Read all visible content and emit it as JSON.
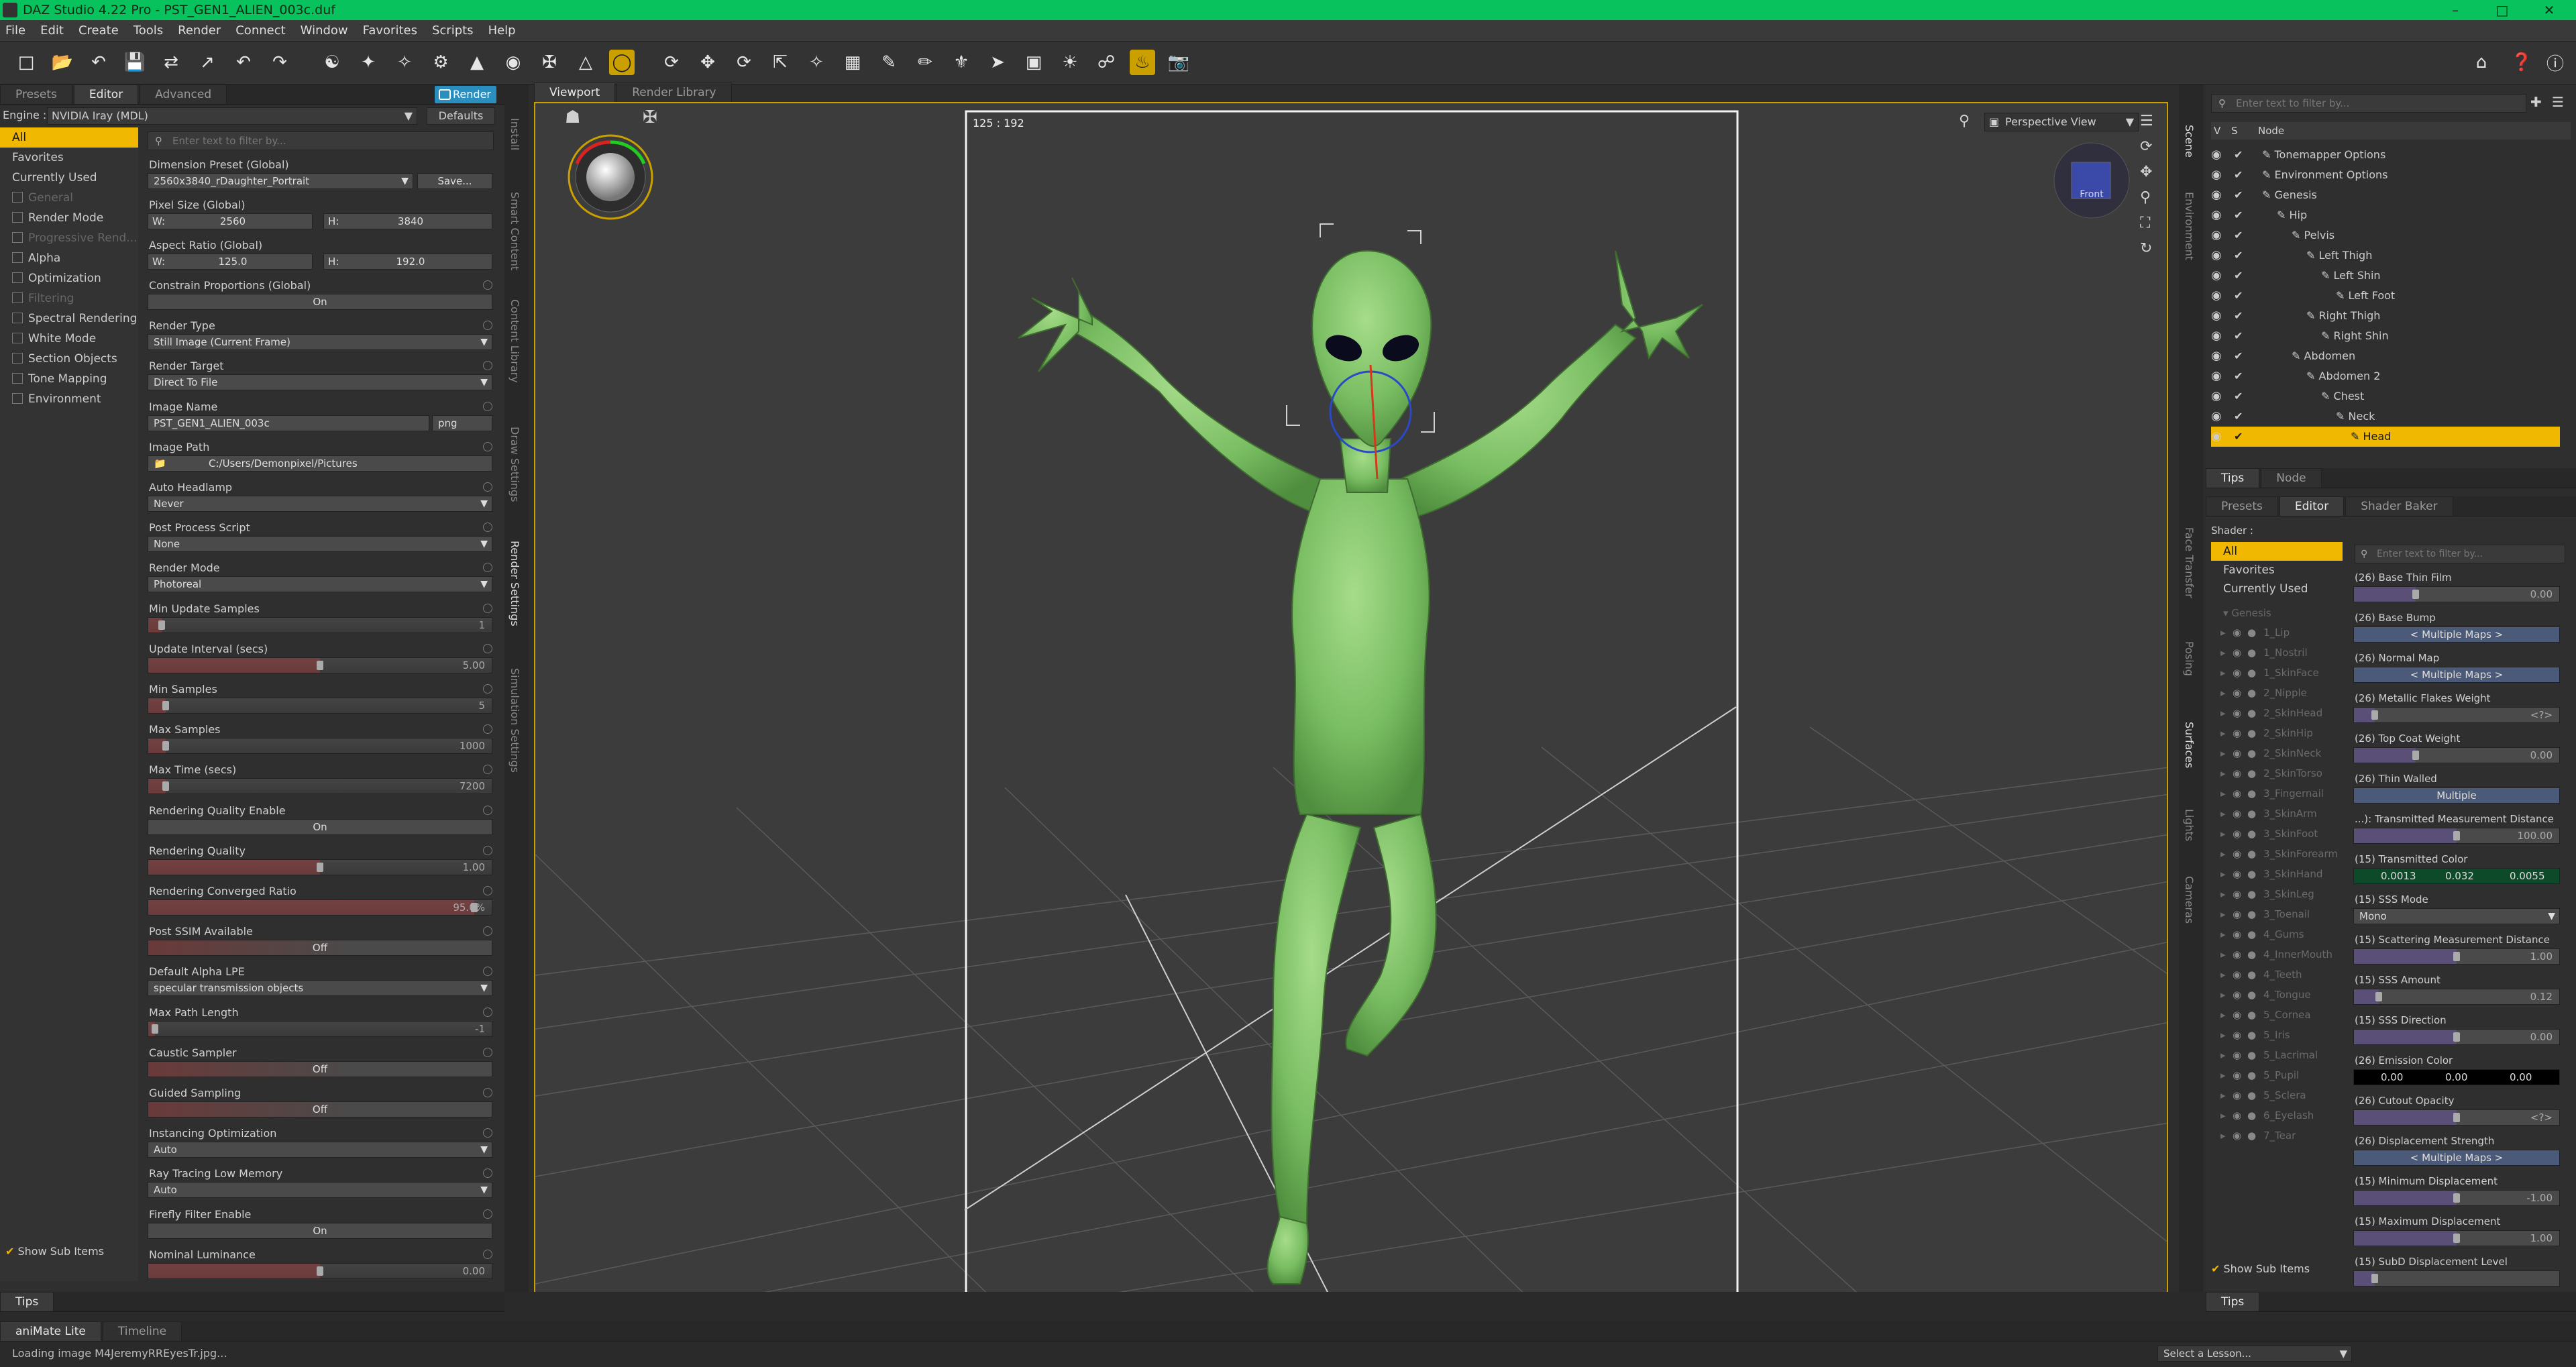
{
  "window": {
    "title": "DAZ Studio 4.22 Pro - PST_GEN1_ALIEN_003c.duf"
  },
  "menu": [
    "File",
    "Edit",
    "Create",
    "Tools",
    "Render",
    "Connect",
    "Window",
    "Favorites",
    "Scripts",
    "Help"
  ],
  "toolbar_icons": [
    "new-file-icon",
    "open-file-icon",
    "open-recent-icon",
    "save-icon",
    "merge-icon",
    "export-icon",
    "undo-icon",
    "redo-icon",
    "create-figure-icon",
    "joint-editor-icon",
    "node-weight-icon",
    "rigging-icon",
    "region-icon",
    "surface-selection-icon",
    "pose-tool-icon",
    "geometry-editor-icon",
    "universal-tool-icon",
    "active-pose-icon",
    "translate-icon",
    "rotate-icon",
    "scale-icon",
    "spot-render-icon",
    "uv-icon",
    "morph-brush-icon",
    "weight-brush-icon",
    "deform-icon",
    "node-select-icon",
    "camera-icon",
    "light-icon",
    "link-icon",
    "render-icon",
    "snapshot-icon"
  ],
  "render_panel": {
    "tabs": [
      "Presets",
      "Editor",
      "Advanced"
    ],
    "render_button": "Render",
    "engine_label": "Engine :",
    "engine_value": "NVIDIA Iray (MDL)",
    "defaults_button": "Defaults",
    "filter_placeholder": "Enter text to filter by...",
    "categories": [
      {
        "label": "All",
        "selected": true,
        "dim": false,
        "box": false
      },
      {
        "label": "Favorites",
        "selected": false,
        "dim": false,
        "box": false
      },
      {
        "label": "Currently Used",
        "selected": false,
        "dim": false,
        "box": false
      },
      {
        "label": "General",
        "selected": false,
        "dim": true,
        "box": true
      },
      {
        "label": "Render Mode",
        "selected": false,
        "dim": false,
        "box": true
      },
      {
        "label": "Progressive Rend...",
        "selected": false,
        "dim": true,
        "box": true
      },
      {
        "label": "Alpha",
        "selected": false,
        "dim": false,
        "box": true
      },
      {
        "label": "Optimization",
        "selected": false,
        "dim": false,
        "box": true
      },
      {
        "label": "Filtering",
        "selected": false,
        "dim": true,
        "box": true
      },
      {
        "label": "Spectral Rendering",
        "selected": false,
        "dim": false,
        "box": true
      },
      {
        "label": "White Mode",
        "selected": false,
        "dim": false,
        "box": true
      },
      {
        "label": "Section Objects",
        "selected": false,
        "dim": false,
        "box": true
      },
      {
        "label": "Tone Mapping",
        "selected": false,
        "dim": false,
        "box": true
      },
      {
        "label": "Environment",
        "selected": false,
        "dim": false,
        "box": true
      }
    ],
    "show_sub_items": "Show Sub Items",
    "side_tabs": [
      "Install",
      "Smart Content",
      "Content Library",
      "Draw Settings",
      "Render Settings",
      "Simulation Settings"
    ],
    "dimension_preset": {
      "label": "Dimension Preset (Global)",
      "value": "2560x3840_rDaughter_Portrait",
      "save": "Save..."
    },
    "pixel_size": {
      "label": "Pixel Size (Global)",
      "w_label": "W:",
      "w": "2560",
      "h_label": "H:",
      "h": "3840"
    },
    "aspect_ratio": {
      "label": "Aspect Ratio (Global)",
      "w_label": "W:",
      "w": "125.0",
      "h_label": "H:",
      "h": "192.0"
    },
    "properties": [
      {
        "label": "Constrain Proportions (Global)",
        "kind": "btn",
        "value": "On",
        "level": null
      },
      {
        "label": "Render Type",
        "kind": "drop",
        "value": "Still Image (Current Frame)",
        "level": null
      },
      {
        "label": "Render Target",
        "kind": "drop",
        "value": "Direct To File",
        "level": null
      },
      {
        "label": "Image Name",
        "kind": "text",
        "value": "PST_GEN1_ALIEN_003c",
        "level": null,
        "ext": "png"
      },
      {
        "label": "Image Path",
        "kind": "path",
        "value": "C:/Users/Demonpixel/Pictures",
        "level": null
      },
      {
        "label": "Auto Headlamp",
        "kind": "drop",
        "value": "Never",
        "level": null
      },
      {
        "label": "Post Process Script",
        "kind": "drop",
        "value": "None",
        "level": null
      },
      {
        "label": "Render Mode",
        "kind": "drop",
        "value": "Photoreal",
        "level": null
      },
      {
        "label": "Min Update Samples",
        "kind": "slider",
        "value": "1",
        "level": 0.04
      },
      {
        "label": "Update Interval (secs)",
        "kind": "slider",
        "value": "5.00",
        "level": 0.5
      },
      {
        "label": "Min Samples",
        "kind": "slider",
        "value": "5",
        "level": 0.05
      },
      {
        "label": "Max Samples",
        "kind": "slider",
        "value": "1000",
        "level": 0.05
      },
      {
        "label": "Max Time (secs)",
        "kind": "slider",
        "value": "7200",
        "level": 0.05
      },
      {
        "label": "Rendering Quality Enable",
        "kind": "btn",
        "value": "On",
        "level": null
      },
      {
        "label": "Rendering Quality",
        "kind": "slider",
        "value": "1.00",
        "level": 0.5
      },
      {
        "label": "Rendering Converged Ratio",
        "kind": "slider",
        "value": "95.0%",
        "level": 0.95
      },
      {
        "label": "Post SSIM Available",
        "kind": "btn",
        "value": "Off",
        "level": null
      },
      {
        "label": "Default Alpha LPE",
        "kind": "drop",
        "value": "specular transmission objects",
        "level": null
      },
      {
        "label": "Max Path Length",
        "kind": "slider",
        "value": "-1",
        "level": 0.02
      },
      {
        "label": "Caustic Sampler",
        "kind": "btn",
        "value": "Off",
        "level": null
      },
      {
        "label": "Guided Sampling",
        "kind": "btn",
        "value": "Off",
        "level": null
      },
      {
        "label": "Instancing Optimization",
        "kind": "drop",
        "value": "Auto",
        "level": null
      },
      {
        "label": "Ray Tracing Low Memory",
        "kind": "drop",
        "value": "Auto",
        "level": null
      },
      {
        "label": "Firefly Filter Enable",
        "kind": "btn",
        "value": "On",
        "level": null
      },
      {
        "label": "Nominal Luminance",
        "kind": "slider",
        "value": "0.00",
        "level": 0.5
      }
    ]
  },
  "viewport": {
    "tabs": [
      "Viewport",
      "Render Library"
    ],
    "frame_ratio": "125 : 192",
    "view_menu": "Perspective View",
    "cube_label": "Front"
  },
  "scene": {
    "filter_placeholder": "Enter text to filter by...",
    "header": [
      "V",
      "S",
      "Node"
    ],
    "nodes": [
      {
        "label": "Tonemapper Options",
        "indent": 0,
        "selected": false
      },
      {
        "label": "Environment Options",
        "indent": 0,
        "selected": false
      },
      {
        "label": "Genesis",
        "indent": 0,
        "selected": false
      },
      {
        "label": "Hip",
        "indent": 1,
        "selected": false
      },
      {
        "label": "Pelvis",
        "indent": 2,
        "selected": false
      },
      {
        "label": "Left Thigh",
        "indent": 3,
        "selected": false
      },
      {
        "label": "Left Shin",
        "indent": 4,
        "selected": false
      },
      {
        "label": "Left Foot",
        "indent": 5,
        "selected": false
      },
      {
        "label": "Right Thigh",
        "indent": 3,
        "selected": false
      },
      {
        "label": "Right Shin",
        "indent": 4,
        "selected": false
      },
      {
        "label": "Abdomen",
        "indent": 2,
        "selected": false
      },
      {
        "label": "Abdomen 2",
        "indent": 3,
        "selected": false
      },
      {
        "label": "Chest",
        "indent": 4,
        "selected": false
      },
      {
        "label": "Neck",
        "indent": 5,
        "selected": false
      },
      {
        "label": "Head",
        "indent": 6,
        "selected": true
      }
    ],
    "bottom_tabs": [
      "Tips",
      "Node"
    ],
    "side_tabs": [
      "Scene",
      "Environment"
    ]
  },
  "surfaces": {
    "tabs": [
      "Presets",
      "Editor",
      "Shader Baker"
    ],
    "shader_label": "Shader :",
    "filter_placeholder": "Enter text to filter by...",
    "categories": [
      "All",
      "Favorites",
      "Currently Used"
    ],
    "root": "Genesis",
    "materials": [
      "1_Lip",
      "1_Nostril",
      "1_SkinFace",
      "2_Nipple",
      "2_SkinHead",
      "2_SkinHip",
      "2_SkinNeck",
      "2_SkinTorso",
      "3_Fingernail",
      "3_SkinArm",
      "3_SkinFoot",
      "3_SkinForearm",
      "3_SkinHand",
      "3_SkinLeg",
      "3_Toenail",
      "4_Gums",
      "4_InnerMouth",
      "4_Teeth",
      "4_Tongue",
      "5_Cornea",
      "5_Iris",
      "5_Lacrimal",
      "5_Pupil",
      "5_Sclera",
      "6_Eyelash",
      "7_Tear"
    ],
    "side_tabs": [
      "Face Transfer",
      "Posing",
      "Surfaces",
      "Lights",
      "Cameras"
    ],
    "properties": [
      {
        "label": "(26) Base Thin Film",
        "kind": "slider",
        "value": "0.00",
        "level": 0.3
      },
      {
        "label": "(26) Base Bump",
        "kind": "maps",
        "value": "< Multiple Maps >",
        "level": null
      },
      {
        "label": "(26) Normal Map",
        "kind": "maps",
        "value": "< Multiple Maps >",
        "level": null
      },
      {
        "label": "(26) Metallic Flakes Weight",
        "kind": "slider",
        "value": "<?>",
        "level": 0.1
      },
      {
        "label": "(26) Top Coat Weight",
        "kind": "slider",
        "value": "0.00",
        "level": 0.3
      },
      {
        "label": "(26) Thin Walled",
        "kind": "maps",
        "value": "Multiple",
        "level": null
      },
      {
        "label": "...): Transmitted Measurement Distance",
        "kind": "slider",
        "value": "100.00",
        "level": 0.5
      },
      {
        "label": "(15) Transmitted Color",
        "kind": "color",
        "value": "",
        "level": null,
        "c1": "0.0013",
        "c2": "0.032",
        "c3": "0.0055"
      },
      {
        "label": "(15) SSS Mode",
        "kind": "drop",
        "value": "Mono",
        "level": null
      },
      {
        "label": "(15) Scattering Measurement Distance",
        "kind": "slider",
        "value": "1.00",
        "level": 0.5
      },
      {
        "label": "(15) SSS Amount",
        "kind": "slider",
        "value": "0.12",
        "level": 0.12
      },
      {
        "label": "(15) SSS Direction",
        "kind": "slider",
        "value": "0.00",
        "level": 0.5
      },
      {
        "label": "(26) Emission Color",
        "kind": "color2",
        "value": "",
        "level": null,
        "c1": "0.00",
        "c2": "0.00",
        "c3": "0.00"
      },
      {
        "label": "(26) Cutout Opacity",
        "kind": "slider",
        "value": "<?>",
        "level": 0.5
      },
      {
        "label": "(26) Displacement Strength",
        "kind": "maps",
        "value": "< Multiple Maps >",
        "level": null
      },
      {
        "label": "(15) Minimum Displacement",
        "kind": "slider",
        "value": "-1.00",
        "level": 0.5
      },
      {
        "label": "(15) Maximum Displacement",
        "kind": "slider",
        "value": "1.00",
        "level": 0.5
      },
      {
        "label": "(15) SubD Displacement Level",
        "kind": "slider",
        "value": "",
        "level": 0.1
      }
    ],
    "show_sub_items": "Show Sub Items",
    "bottom_tab": "Tips"
  },
  "bottom": {
    "left_tab": "Tips",
    "timeline_tabs": [
      "aniMate Lite",
      "Timeline"
    ],
    "status": "Loading image M4JeremyRREyesTr.jpg...",
    "lesson": "Select a Lesson..."
  },
  "colors": {
    "accent": "#f0b800",
    "titlebar": "#07c25d",
    "alien": "#7fc466"
  }
}
